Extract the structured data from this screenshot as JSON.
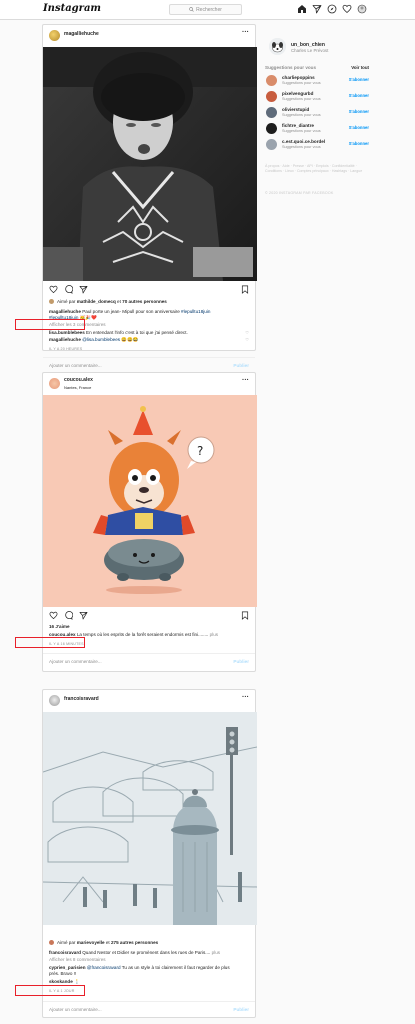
{
  "app": {
    "logo_text": "Instagram",
    "search_placeholder": "Rechercher"
  },
  "nav_icons": [
    "home-icon",
    "explore-compass-icon",
    "direct-send-icon",
    "activity-heart-icon",
    "profile-icon"
  ],
  "posts": [
    {
      "username": "magalliehuche",
      "location": "",
      "image_desc": "black-and-white-photo",
      "liked_by_prefix": "Aimé par",
      "liked_by_user": "mathilde_domecq",
      "liked_by_suffix": "et",
      "likes_count": "70 autres personnes",
      "caption_user": "magalliehuche",
      "caption_text": "Paul porte un jean- Mipull pour son anniversaire",
      "caption_tags_1": "#lepulltu18juin",
      "caption_tags_2": "#lepulltu18juin",
      "caption_emoji": "🥳🎉❤️",
      "view_comments": "Afficher les 3 commentaires",
      "comments": [
        {
          "user": "lisa.bumblebees",
          "text": "En entendant l'info c'est à toi que j'ai pensé direct."
        },
        {
          "user": "magalliehuche",
          "mention": "@lisa.bumblebees",
          "text": "😄😄😂"
        }
      ],
      "time": "IL Y A 20 HEURES",
      "comment_placeholder": "Ajouter un commentaire...",
      "publish": "Publier"
    },
    {
      "username": "coucou.alex",
      "location": "Nantes, France",
      "image_desc": "illustration-creature-party-hat",
      "likes": "16 J'aime",
      "caption_user": "coucou.alex",
      "caption_text": "La temps où les esprits de la forêt seraient endormis est fini........",
      "caption_more": "plus",
      "time": "IL Y A 16 MINUTES",
      "comment_placeholder": "Ajouter un commentaire...",
      "publish": "Publier"
    },
    {
      "username": "francoisravard",
      "location": "",
      "image_desc": "pencil-street-scene-morris-column",
      "liked_by_prefix": "Aimé par",
      "liked_by_user": "marievoyelle",
      "liked_by_suffix": "et",
      "likes_count": "275 autres personnes",
      "caption_user": "francoisravard",
      "caption_text": "Quand Nestor et Didier se promènent dans les rues de Paris....",
      "caption_more": "plus",
      "view_comments": "Afficher les 8 commentaires",
      "comments": [
        {
          "user": "cyprien_parisien",
          "mention": "@francoisravard",
          "text": "Tu as un style à toi clairement il faut regarder de plus"
        },
        {
          "user": "",
          "text": "près. Bravo !!"
        },
        {
          "user": "skoskande",
          "text": "🕯️"
        }
      ],
      "time": "IL Y A 1 JOUR",
      "comment_placeholder": "Ajouter un commentaire...",
      "publish": "Publier"
    }
  ],
  "sidebar": {
    "me_username": "un_bon_chien",
    "me_name": "Charles Le Prévost",
    "suggestions_title": "Suggestions pour vous",
    "see_all": "Voir tout",
    "follow_label": "S'abonner",
    "suggestions": [
      {
        "username": "charliepoppins",
        "sub": "Suggestions pour vous",
        "color": "#d98c6a"
      },
      {
        "username": "pixelvengurbd",
        "sub": "Suggestions pour vous",
        "color": "#c85d3f"
      },
      {
        "username": "olivierstupid",
        "sub": "Suggestions pour vous",
        "color": "#5f6b7a"
      },
      {
        "username": "fichtre_diantre",
        "sub": "Suggestions pour vous",
        "color": "#1d1d1d"
      },
      {
        "username": "c.est.quoi.ce.bordel",
        "sub": "Suggestions pour vous",
        "color": "#9aa3ad"
      }
    ],
    "footer_links": "À propos · Aide · Presse · API · Emplois · Confidentialité · Conditions · Lieux · Comptes principaux · Hashtags · Langue",
    "copyright": "© 2020 INSTAGRAM PAR FACEBOOK"
  },
  "colors": {
    "accent_blue": "#0095f6",
    "highlight_red": "#e8202a",
    "post2_bg": "#f8c9b5"
  }
}
